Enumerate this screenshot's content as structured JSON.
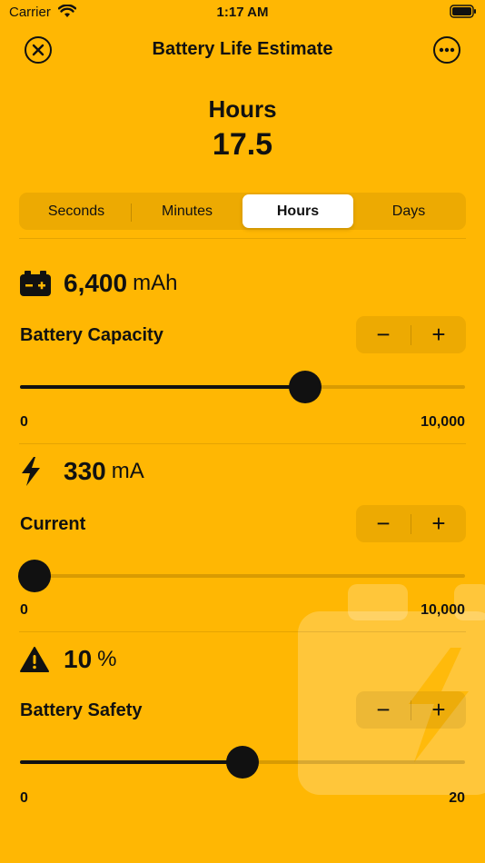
{
  "status_bar": {
    "carrier": "Carrier",
    "time": "1:17 AM"
  },
  "nav": {
    "title": "Battery Life Estimate",
    "close_icon": "close-circle-icon",
    "more_icon": "ellipsis-circle-icon"
  },
  "result": {
    "unit": "Hours",
    "value": "17.5"
  },
  "segments": [
    {
      "label": "Seconds",
      "selected": false
    },
    {
      "label": "Minutes",
      "selected": false
    },
    {
      "label": "Hours",
      "selected": true
    },
    {
      "label": "Days",
      "selected": false
    }
  ],
  "capacity": {
    "icon": "car-battery-icon",
    "value": "6,400",
    "unit": "mAh",
    "label": "Battery Capacity",
    "min": "0",
    "max": "10,000",
    "slider_fraction": 0.64,
    "minus": "−",
    "plus": "+"
  },
  "current": {
    "icon": "bolt-icon",
    "value": "330",
    "unit": "mA",
    "label": "Current",
    "min": "0",
    "max": "10,000",
    "slider_fraction": 0.033,
    "minus": "−",
    "plus": "+"
  },
  "safety": {
    "icon": "warning-triangle-icon",
    "value": "10",
    "unit": "%",
    "label": "Battery Safety",
    "min": "0",
    "max": "20",
    "slider_fraction": 0.5,
    "minus": "−",
    "plus": "+"
  },
  "colors": {
    "background": "#FFB703",
    "foreground": "#111111",
    "segment_active": "#FFFFFF"
  }
}
